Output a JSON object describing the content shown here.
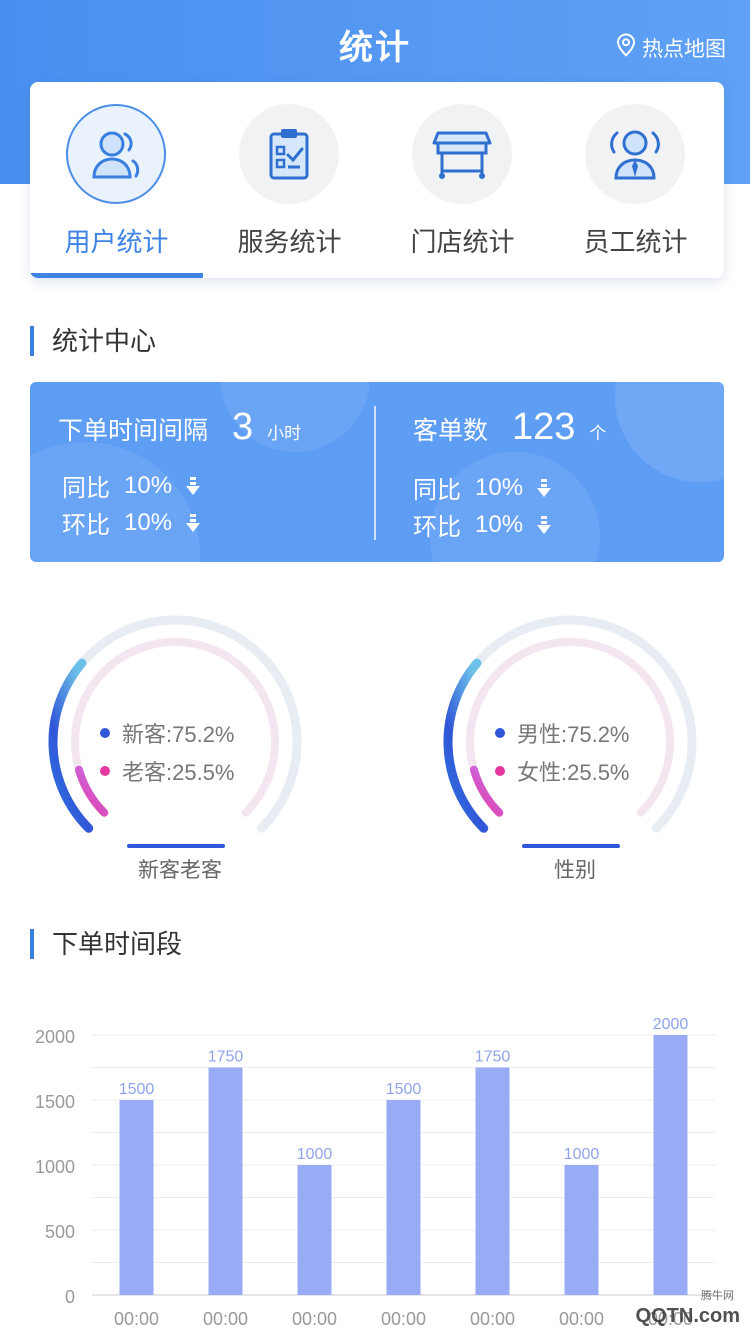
{
  "header": {
    "title": "统计",
    "hotmap_label": "热点地图",
    "gradient_start": "#4a8ff0",
    "gradient_end": "#5fa1f5"
  },
  "tabs": [
    {
      "label": "用户统计",
      "icon": "user-icon",
      "active": true
    },
    {
      "label": "服务统计",
      "icon": "clipboard-checklist-icon",
      "active": false
    },
    {
      "label": "门店统计",
      "icon": "store-counter-icon",
      "active": false
    },
    {
      "label": "员工统计",
      "icon": "staff-icon",
      "active": false
    }
  ],
  "stats_section": {
    "title": "统计中心",
    "left": {
      "label": "下单时间间隔",
      "value": "3",
      "unit": "小时",
      "yoy_label": "同比",
      "yoy_value": "10%",
      "mom_label": "环比",
      "mom_value": "10%"
    },
    "right": {
      "label": "客单数",
      "value": "123",
      "unit": "个",
      "yoy_label": "同比",
      "yoy_value": "10%",
      "mom_label": "环比",
      "mom_value": "10%"
    },
    "card_color": "#5e9df4"
  },
  "gauges": [
    {
      "caption": "新客老客",
      "items": [
        {
          "label": "新客:75.2%",
          "value": 75.2,
          "color": "#3156d8"
        },
        {
          "label": "老客:25.5%",
          "value": 25.5,
          "color": "#e5389f"
        }
      ]
    },
    {
      "caption": "性别",
      "items": [
        {
          "label": "男性:75.2%",
          "value": 75.2,
          "color": "#3156d8"
        },
        {
          "label": "女性:25.5%",
          "value": 25.5,
          "color": "#e5389f"
        }
      ]
    }
  ],
  "orders_section": {
    "title": "下单时间段"
  },
  "chart_data": {
    "type": "bar",
    "categories": [
      "00:00",
      "00:00",
      "00:00",
      "00:00",
      "00:00",
      "00:00",
      "00:00"
    ],
    "values": [
      1500,
      1750,
      1000,
      1500,
      1750,
      1000,
      2000
    ],
    "yticks": [
      0,
      500,
      1000,
      1500,
      2000
    ],
    "ylim": [
      0,
      2000
    ],
    "bar_color": "#9aabf5",
    "label_color": "#8fa3ec",
    "grid": true
  },
  "watermark": {
    "text": "QQTN.com",
    "small": "腾牛网"
  }
}
